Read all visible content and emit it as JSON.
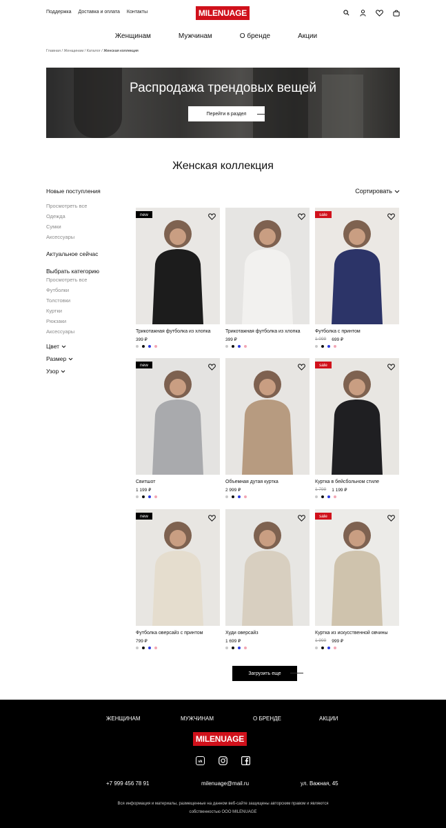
{
  "header": {
    "top_links": [
      "Поддержка",
      "Доставка и оплата",
      "Контакты"
    ],
    "logo": "MILENUAGE",
    "icons": [
      "search-icon",
      "user-icon",
      "heart-icon",
      "bag-icon"
    ]
  },
  "nav": [
    "Женщинам",
    "Мужчинам",
    "О бренде",
    "Акции"
  ],
  "breadcrumb": {
    "items": [
      "Главная",
      "Женщинам",
      "Каталог"
    ],
    "current": "Женская коллекция"
  },
  "banner": {
    "title": "Распродажа трендовых вещей",
    "button": "Перейти в раздел"
  },
  "section_title": "Женская коллекция",
  "sidebar": {
    "new_title": "Новые поступления",
    "new_items": [
      "Просмотреть все",
      "Одежда",
      "Сумки",
      "Аксессуары"
    ],
    "current_title": "Актуальное сейчас",
    "category_title": "Выбрать категорию",
    "category_items": [
      "Просмотреть все",
      "Футболки",
      "Толстовки",
      "Куртки",
      "Рюкзаки",
      "Аксессуары"
    ],
    "filters": [
      "Цвет",
      "Размер",
      "Узор"
    ]
  },
  "sort_label": "Сортировать",
  "colors": {
    "brand": "#d0111b",
    "sale": "#d0111b",
    "new": "#000000"
  },
  "products": [
    {
      "name": "Трикотажная футболка из хлопка",
      "price": "399 ₽",
      "old_price": "",
      "badge": "new"
    },
    {
      "name": "Трикотажная футболка из хлопка",
      "price": "399 ₽",
      "old_price": "",
      "badge": ""
    },
    {
      "name": "Футболка с принтом",
      "price": "699 ₽",
      "old_price": "1 099",
      "badge": "sale"
    },
    {
      "name": "Свитшот",
      "price": "1 199 ₽",
      "old_price": "",
      "badge": "new"
    },
    {
      "name": "Объемная дутая куртка",
      "price": "2 999 ₽",
      "old_price": "",
      "badge": ""
    },
    {
      "name": "Куртка в бейсбольном стиле",
      "price": "1 199 ₽",
      "old_price": "1 799",
      "badge": "sale"
    },
    {
      "name": "Футболка оверсайз с принтом",
      "price": "799 ₽",
      "old_price": "",
      "badge": "new"
    },
    {
      "name": "Худи оверсайз",
      "price": "1 699 ₽",
      "old_price": "",
      "badge": ""
    },
    {
      "name": "Куртка из искусственной овчины",
      "price": "999 ₽",
      "old_price": "1 999",
      "badge": "sale"
    }
  ],
  "swatches": [
    "#c8c8c8",
    "#111111",
    "#2b3be0",
    "#f2a6b4"
  ],
  "load_more": "Загрузить еще",
  "footer": {
    "nav": [
      "ЖЕНЩИНАМ",
      "МУЖЧИНАМ",
      "О БРЕНДЕ",
      "АКЦИИ"
    ],
    "logo": "MILENUAGE",
    "socials": [
      "vk-icon",
      "instagram-icon",
      "facebook-icon"
    ],
    "phone": "+7 999 456 78 91",
    "email": "milenuage@mail.ru",
    "address": "ул. Важная, 45",
    "copyright": "Вся информация и материалы, размещенные на данном веб-сайте защищены авторским правом и являются собственностью ООО MILENUAGE"
  }
}
